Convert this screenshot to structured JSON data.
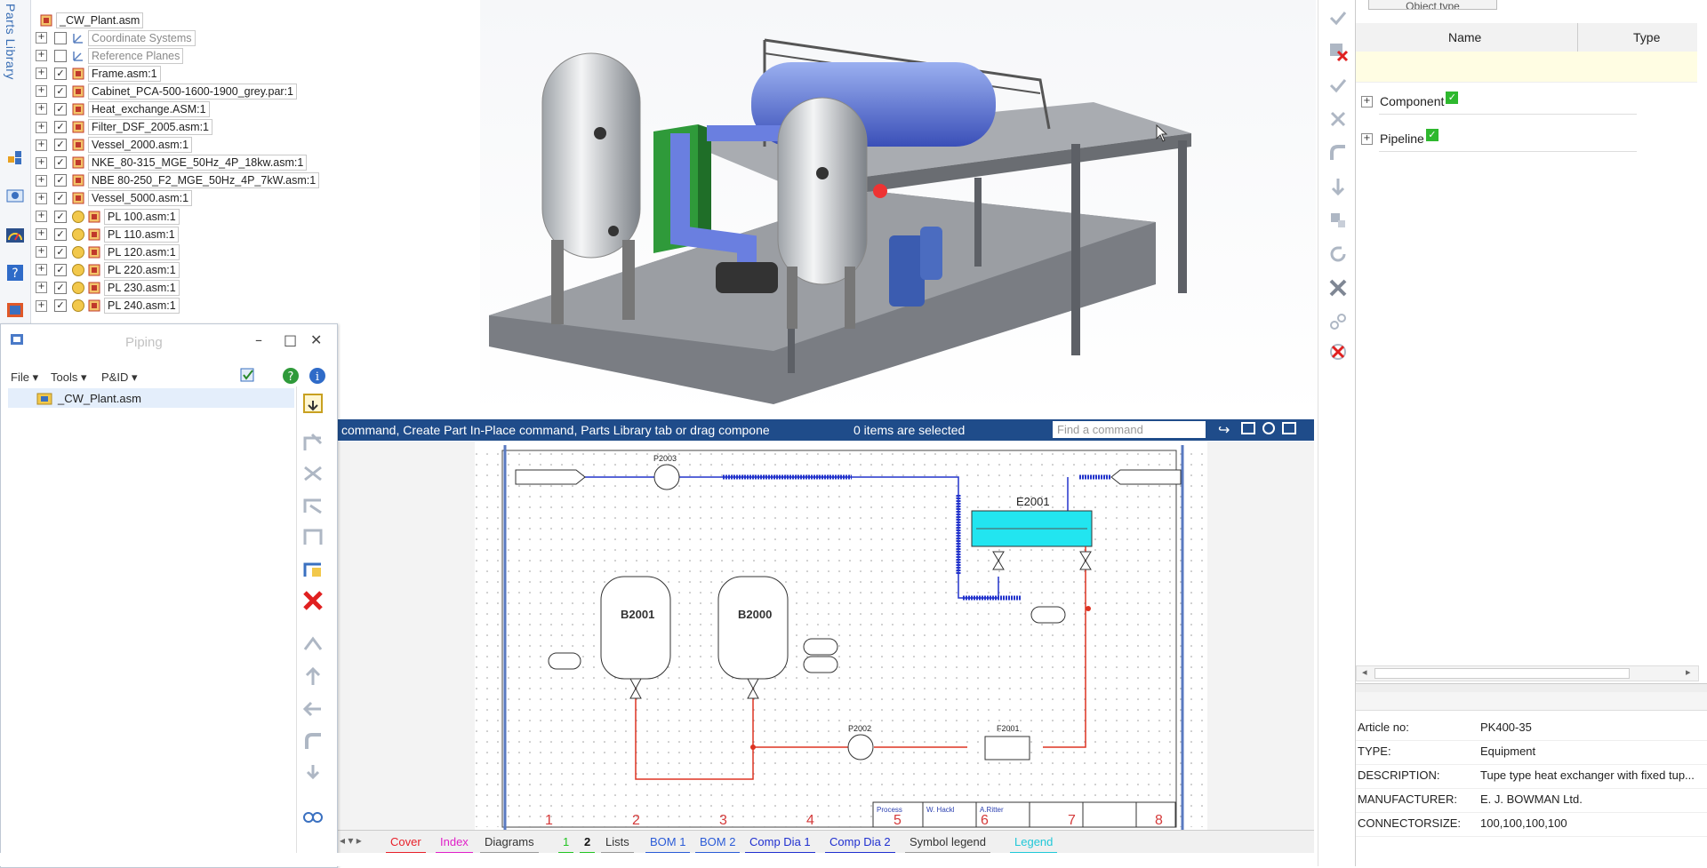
{
  "left_tabs": {
    "parts_library": "Parts Library"
  },
  "tree": {
    "root": "_CW_Plant.asm",
    "items": [
      {
        "label": "Coordinate Systems",
        "checked": false,
        "dim": true
      },
      {
        "label": "Reference Planes",
        "checked": false,
        "dim": true
      },
      {
        "label": "Frame.asm:1",
        "checked": true
      },
      {
        "label": "Cabinet_PCA-500-1600-1900_grey.par:1",
        "checked": true
      },
      {
        "label": "Heat_exchange.ASM:1",
        "checked": true
      },
      {
        "label": "Filter_DSF_2005.asm:1",
        "checked": true
      },
      {
        "label": "Vessel_2000.asm:1",
        "checked": true
      },
      {
        "label": "NKE_80-315_MGE_50Hz_4P_18kw.asm:1",
        "checked": true
      },
      {
        "label": "NBE 80-250_F2_MGE_50Hz_4P_7kW.asm:1",
        "checked": true
      },
      {
        "label": "Vessel_5000.asm:1",
        "checked": true
      },
      {
        "label": "PL 100.asm:1",
        "checked": true
      },
      {
        "label": "PL 110.asm:1",
        "checked": true
      },
      {
        "label": "PL 120.asm:1",
        "checked": true
      },
      {
        "label": "PL 220.asm:1",
        "checked": true
      },
      {
        "label": "PL 230.asm:1",
        "checked": true
      },
      {
        "label": "PL 240.asm:1",
        "checked": true
      }
    ]
  },
  "piping": {
    "title": "Piping",
    "menu_file": "File",
    "menu_tools": "Tools",
    "menu_pid": "P&ID",
    "tree_item": "_CW_Plant.asm"
  },
  "statusbar": {
    "prompt": "command, Create Part In-Place command, Parts Library tab or drag compone",
    "selection": "0 items are selected",
    "find_placeholder": "Find a command"
  },
  "pid": {
    "vessel1": "B2001",
    "vessel2": "B2000",
    "exchanger": "E2001",
    "pump1": "P2003",
    "pump2": "P2002",
    "filter": "F2001",
    "zones": [
      "1",
      "2",
      "3",
      "4",
      "5",
      "6",
      "7",
      "8"
    ],
    "titleblock": {
      "process": "Process",
      "drawn": "W. Hackl",
      "checked": "A.Ritter"
    }
  },
  "tabs": [
    {
      "label": "Cover",
      "color": "#e8202a"
    },
    {
      "label": "Index",
      "color": "#e020c8"
    },
    {
      "label": "Diagrams",
      "color": "#999999"
    },
    {
      "label": "1",
      "color": "#22c422"
    },
    {
      "label": "2",
      "color": "#22c422"
    },
    {
      "label": "Lists",
      "color": "#999999"
    },
    {
      "label": "BOM 1",
      "color": "#2a5bd7"
    },
    {
      "label": "BOM 2",
      "color": "#2a5bd7"
    },
    {
      "label": "Comp Dia 1",
      "color": "#1f2fd0"
    },
    {
      "label": "Comp Dia 2",
      "color": "#1f2fd0"
    },
    {
      "label": "Symbol legend",
      "color": "#999999"
    },
    {
      "label": "Legend",
      "color": "#20c8d8"
    }
  ],
  "right_panel": {
    "object_type": "Object type",
    "col_name": "Name",
    "col_type": "Type",
    "groups": [
      "Component",
      "Pipeline"
    ],
    "properties": [
      {
        "key": "Article no:",
        "value": "PK400-35"
      },
      {
        "key": "TYPE:",
        "value": "Equipment"
      },
      {
        "key": "DESCRIPTION:",
        "value": "Tupe type heat exchanger with fixed tup..."
      },
      {
        "key": "MANUFACTURER:",
        "value": "E. J. BOWMAN Ltd."
      },
      {
        "key": "CONNECTORSIZE:",
        "value": "100,100,100,100"
      }
    ]
  }
}
